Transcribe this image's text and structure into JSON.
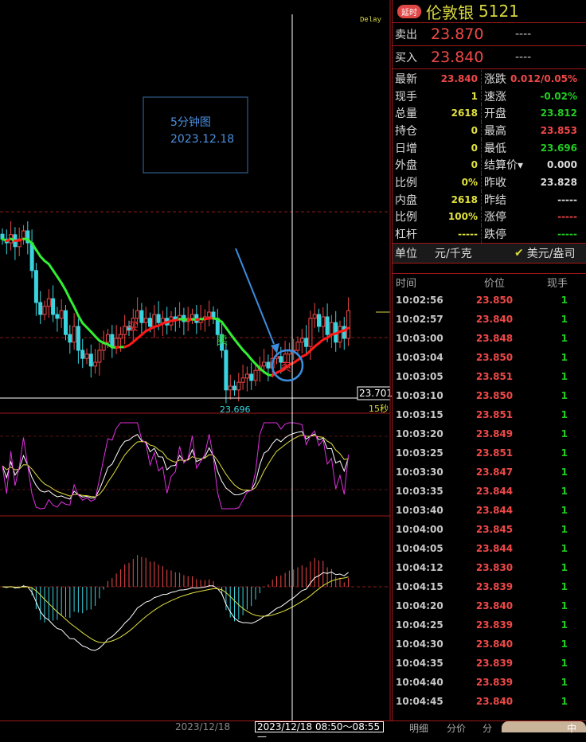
{
  "chart": {
    "delay": "Delay",
    "info_line1": "5分钟图",
    "info_line2": "2023.12.18",
    "price_label": "23.701",
    "low_label": "23.696",
    "interval": "15秒",
    "buy1": "买",
    "sell": "卖",
    "buy2": "买"
  },
  "chart_data": {
    "type": "candlestick",
    "closes": [
      24.034,
      24.026,
      24.043,
      24.018,
      24.034,
      24.051,
      24.026,
      23.968,
      23.901,
      23.876,
      23.893,
      23.909,
      23.876,
      23.868,
      23.884,
      23.834,
      23.818,
      23.851,
      23.801,
      23.784,
      23.793,
      23.768,
      23.776,
      23.801,
      23.818,
      23.834,
      23.809,
      23.826,
      23.834,
      23.851,
      23.843,
      23.868,
      23.884,
      23.859,
      23.868,
      23.851,
      23.876,
      23.859,
      23.868,
      23.854,
      23.871,
      23.864,
      23.874,
      23.861,
      23.868,
      23.876,
      23.859,
      23.868,
      23.871,
      23.881,
      23.868,
      23.834,
      23.801,
      23.718,
      23.726,
      23.718,
      23.734,
      23.743,
      23.751,
      23.738,
      23.759,
      23.768,
      23.776,
      23.764,
      23.784,
      23.788,
      23.776,
      23.793,
      23.801,
      23.801,
      23.818,
      23.826,
      23.809,
      23.868,
      23.876,
      23.851,
      23.871,
      23.834,
      23.859,
      23.818,
      23.851,
      23.826,
      23.884
    ],
    "colors": {
      "up": "#f04848",
      "down": "#3ad4e0",
      "ma_up": "#ff1a1a",
      "ma_down": "#33ee33"
    }
  },
  "header": {
    "badge": "延时",
    "name": "伦敦银",
    "code": "5121"
  },
  "sell": {
    "label": "卖出",
    "price": "23.870",
    "vol": "----"
  },
  "buy": {
    "label": "买入",
    "price": "23.840",
    "vol": "----"
  },
  "stats": [
    {
      "l": "最新",
      "v": "23.840",
      "c": "#f04848"
    },
    {
      "l": "涨跌",
      "v": "0.012/0.05%",
      "c": "#f04848"
    },
    {
      "l": "现手",
      "v": "1",
      "c": "#e0e040"
    },
    {
      "l": "速涨",
      "v": "-0.02%",
      "c": "#22cc22"
    },
    {
      "l": "总量",
      "v": "2618",
      "c": "#e0e040"
    },
    {
      "l": "开盘",
      "v": "23.812",
      "c": "#22cc22"
    },
    {
      "l": "持仓",
      "v": "0",
      "c": "#e0e040"
    },
    {
      "l": "最高",
      "v": "23.853",
      "c": "#f04848"
    },
    {
      "l": "日增",
      "v": "0",
      "c": "#e0e040"
    },
    {
      "l": "最低",
      "v": "23.696",
      "c": "#22cc22"
    },
    {
      "l": "外盘",
      "v": "0",
      "c": "#e0e040"
    },
    {
      "l": "结算价▾",
      "v": "0.000",
      "c": "#ddd"
    },
    {
      "l": "比例",
      "v": "0%",
      "c": "#e0e040"
    },
    {
      "l": "昨收",
      "v": "23.828",
      "c": "#ddd"
    },
    {
      "l": "内盘",
      "v": "2618",
      "c": "#e0e040"
    },
    {
      "l": "昨结",
      "v": "-----",
      "c": "#ddd"
    },
    {
      "l": "比例",
      "v": "100%",
      "c": "#e0e040"
    },
    {
      "l": "涨停",
      "v": "-----",
      "c": "#f04848"
    },
    {
      "l": "杠杆",
      "v": "-----",
      "c": "#e0e040"
    },
    {
      "l": "跌停",
      "v": "-----",
      "c": "#22cc22"
    }
  ],
  "unit": {
    "label": "单位",
    "value": "元/千克",
    "alt": "美元/盎司"
  },
  "ticks": {
    "headers": [
      "时间",
      "价位",
      "现手"
    ],
    "rows": [
      [
        "10:02:56",
        "23.850",
        "1"
      ],
      [
        "10:02:57",
        "23.840",
        "1"
      ],
      [
        "10:03:00",
        "23.848",
        "1"
      ],
      [
        "10:03:04",
        "23.850",
        "1"
      ],
      [
        "10:03:05",
        "23.851",
        "1"
      ],
      [
        "10:03:10",
        "23.850",
        "1"
      ],
      [
        "10:03:15",
        "23.851",
        "1"
      ],
      [
        "10:03:20",
        "23.849",
        "1"
      ],
      [
        "10:03:25",
        "23.851",
        "1"
      ],
      [
        "10:03:30",
        "23.847",
        "1"
      ],
      [
        "10:03:35",
        "23.844",
        "1"
      ],
      [
        "10:03:40",
        "23.844",
        "1"
      ],
      [
        "10:04:00",
        "23.845",
        "1"
      ],
      [
        "10:04:05",
        "23.844",
        "1"
      ],
      [
        "10:04:12",
        "23.830",
        "1"
      ],
      [
        "10:04:15",
        "23.839",
        "1"
      ],
      [
        "10:04:20",
        "23.840",
        "1"
      ],
      [
        "10:04:25",
        "23.839",
        "1"
      ],
      [
        "10:04:30",
        "23.840",
        "1"
      ],
      [
        "10:04:35",
        "23.839",
        "1"
      ],
      [
        "10:04:40",
        "23.839",
        "1"
      ],
      [
        "10:04:45",
        "23.840",
        "1"
      ]
    ]
  },
  "bottom": {
    "date": "2023/12/18",
    "range": "2023/12/18 08:50～08:55 —",
    "tabs": [
      "明细",
      "分价",
      "分"
    ],
    "ime": "中"
  }
}
